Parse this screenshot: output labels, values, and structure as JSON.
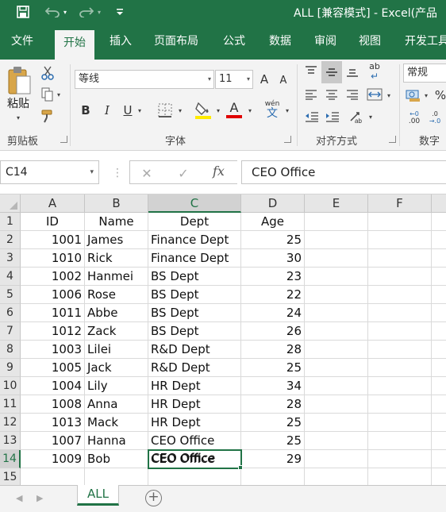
{
  "title": "ALL  [兼容模式]  -  Excel(产品",
  "quick_access": {
    "save_icon": "save-icon",
    "undo_icon": "undo-icon",
    "redo_icon": "redo-icon"
  },
  "tabs": [
    "文件",
    "开始",
    "插入",
    "页面布局",
    "公式",
    "数据",
    "审阅",
    "视图",
    "开发工具"
  ],
  "active_tab": "开始",
  "ribbon": {
    "clipboard": {
      "paste_label": "粘贴",
      "group_label": "剪贴板"
    },
    "font": {
      "font_name": "等线",
      "font_size": "11",
      "grow_label": "A",
      "shrink_label": "A",
      "bold": "B",
      "italic": "I",
      "underline": "U",
      "font_color_label": "A",
      "phonetic_label": "wén",
      "group_label": "字体"
    },
    "alignment": {
      "wrap_label": "ab",
      "group_label": "对齐方式"
    },
    "number": {
      "format": "常规",
      "percent": "%",
      "inc_decimal": ".00",
      "dec_decimal": ".0",
      "group_label": "数字"
    }
  },
  "formula_bar": {
    "name_box": "C14",
    "fx": "fx",
    "value": "CEO Office"
  },
  "columns": [
    "A",
    "B",
    "C",
    "D",
    "E",
    "F"
  ],
  "selected_column": "C",
  "row_numbers": [
    "1",
    "2",
    "3",
    "4",
    "5",
    "6",
    "7",
    "8",
    "9",
    "10",
    "11",
    "12",
    "13",
    "14",
    "15"
  ],
  "selected_row": "14",
  "header_row": [
    "ID",
    "Name",
    "Dept",
    "Age"
  ],
  "rows": [
    [
      "1001",
      "James",
      "Finance Dept",
      "25"
    ],
    [
      "1010",
      "Rick",
      "Finance Dept",
      "30"
    ],
    [
      "1002",
      "Hanmei",
      "BS Dept",
      "23"
    ],
    [
      "1006",
      "Rose",
      "BS Dept",
      "22"
    ],
    [
      "1011",
      "Abbe",
      "BS Dept",
      "24"
    ],
    [
      "1012",
      "Zack",
      "BS Dept",
      "26"
    ],
    [
      "1003",
      "Lilei",
      "R&D Dept",
      "28"
    ],
    [
      "1005",
      "Jack",
      "R&D Dept",
      "25"
    ],
    [
      "1004",
      "Lily",
      "HR Dept",
      "34"
    ],
    [
      "1008",
      "Anna",
      "HR Dept",
      "28"
    ],
    [
      "1013",
      "Mack",
      "HR Dept",
      "25"
    ],
    [
      "1007",
      "Hanna",
      "CEO Office",
      "25"
    ],
    [
      "1009",
      "Bob",
      "CEO Office",
      "29"
    ]
  ],
  "sheet_tabs": [
    "ALL"
  ],
  "active_sheet": "ALL",
  "colors": {
    "accent": "#217346",
    "ribbon_bg": "#f3f3f3",
    "header_bg": "#e6e6e6"
  }
}
